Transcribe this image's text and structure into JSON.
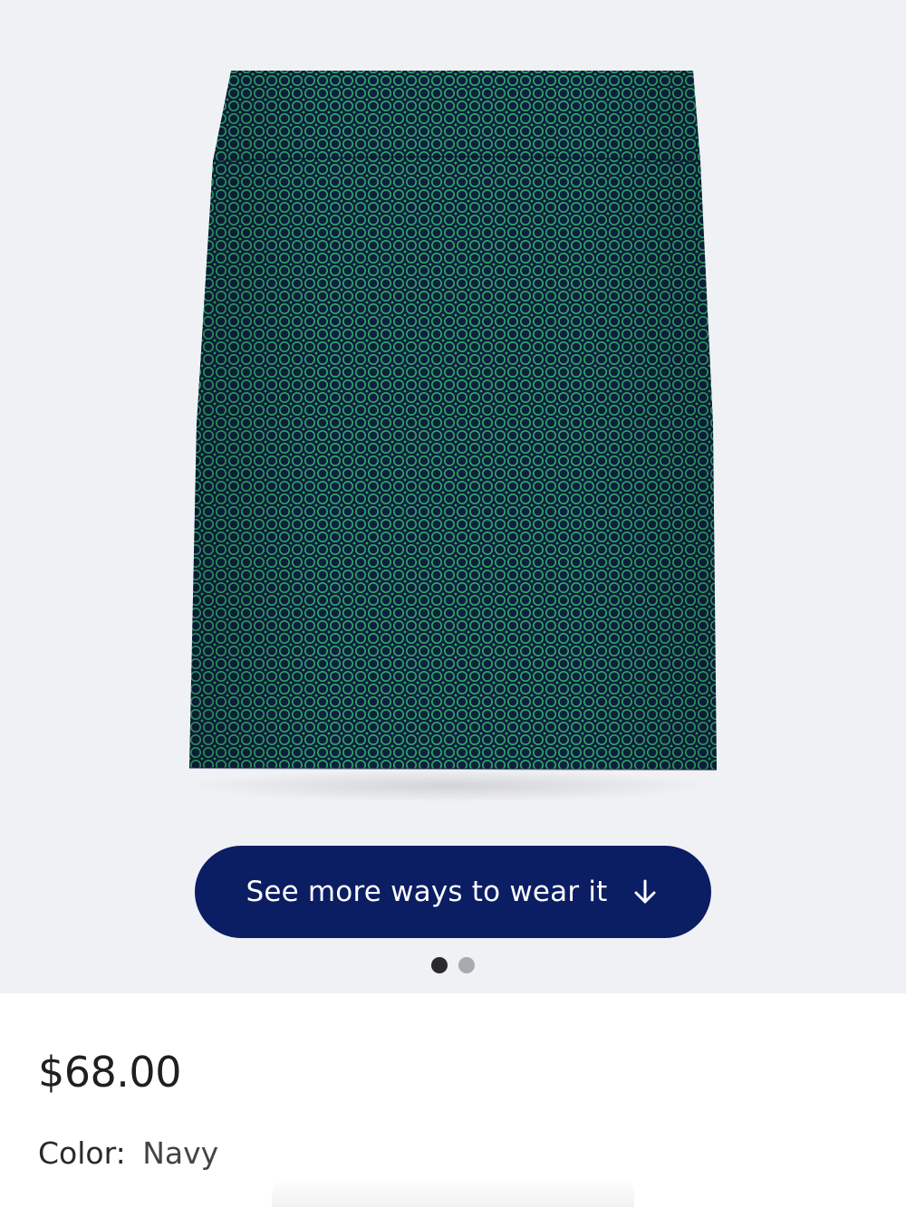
{
  "product": {
    "image_alt": "Navy pencil skirt with green geometric print",
    "pattern_colors": {
      "base": "#0f2040",
      "accent": "#2fae6a",
      "background": "#f0f1f5"
    }
  },
  "cta": {
    "label": "See more ways to wear it",
    "icon": "arrow-down-icon",
    "color": "#0b1d63"
  },
  "carousel": {
    "slide_count": 2,
    "active_index": 0
  },
  "price": "$68.00",
  "color": {
    "label": "Color:",
    "value": "Navy"
  }
}
